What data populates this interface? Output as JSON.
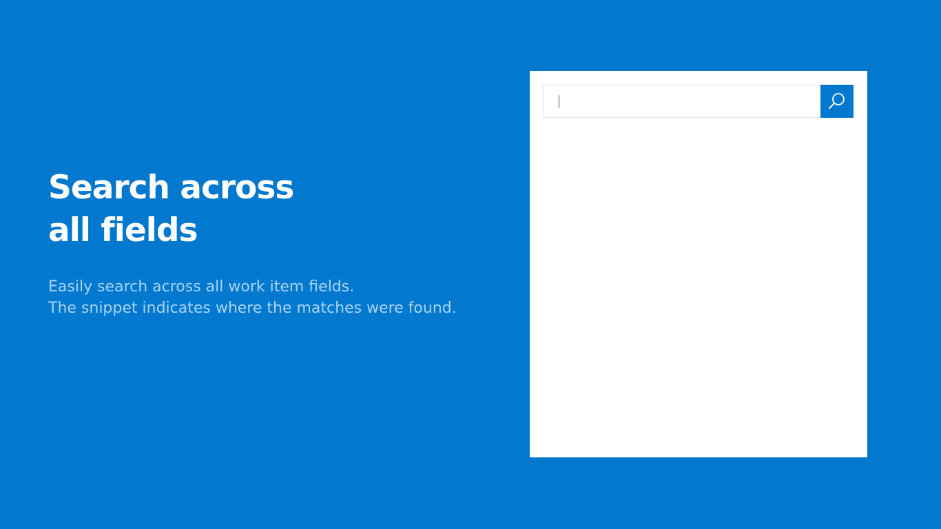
{
  "colors": {
    "background": "#0278CF",
    "headline": "#FFFFFF",
    "description": "#A9D4F4",
    "panel": "#FFFFFF",
    "search_button": "#0278CF"
  },
  "headline": {
    "line1": "Search across",
    "line2": "all fields"
  },
  "description": {
    "line1": "Easily search across all work item fields.",
    "line2": "The snippet indicates where the matches were found."
  },
  "search": {
    "value": "",
    "button_icon": "search-icon"
  }
}
